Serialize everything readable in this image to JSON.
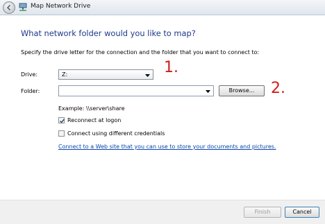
{
  "window": {
    "title": "Map Network Drive"
  },
  "heading": "What network folder would you like to map?",
  "instruction": "Specify the drive letter for the connection and the folder that you want to connect to:",
  "drive": {
    "label": "Drive:",
    "value": "Z:"
  },
  "folder": {
    "label": "Folder:",
    "value": "",
    "browse_label": "Browse..."
  },
  "example": "Example: \\\\server\\share",
  "options": {
    "reconnect": {
      "label": "Reconnect at logon",
      "checked": true
    },
    "different_credentials": {
      "label": "Connect using different credentials",
      "checked": false
    }
  },
  "link": "Connect to a Web site that you can use to store your documents and pictures.",
  "annotations": {
    "first": "1.",
    "second": "2.",
    "color": "#d21b1b"
  },
  "footer": {
    "finish_label": "Finish",
    "cancel_label": "Cancel"
  },
  "colors": {
    "heading": "#1e3a8a",
    "link": "#0645ad"
  },
  "icons": {
    "back": "back-arrow-icon",
    "network": "network-drive-icon",
    "dropdown": "chevron-down-icon",
    "checkmark": "checkmark-icon"
  }
}
